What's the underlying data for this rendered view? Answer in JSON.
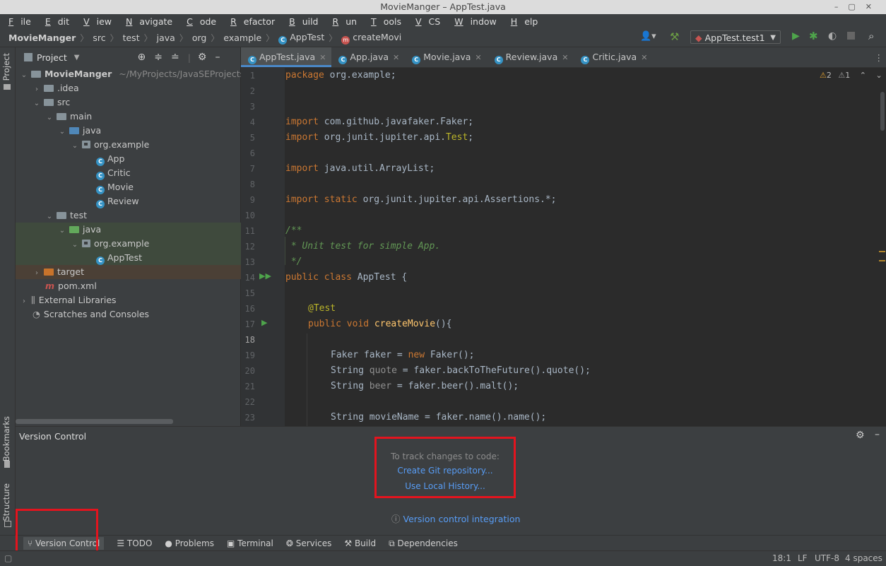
{
  "window": {
    "title": "MovieManger – AppTest.java"
  },
  "menu": {
    "items": [
      {
        "u": "F",
        "rest": "ile"
      },
      {
        "u": "E",
        "rest": "dit"
      },
      {
        "u": "V",
        "rest": "iew"
      },
      {
        "u": "N",
        "rest": "avigate"
      },
      {
        "u": "C",
        "rest": "ode"
      },
      {
        "u": "R",
        "rest": "efactor"
      },
      {
        "u": "B",
        "rest": "uild"
      },
      {
        "u": "R",
        "rest": "un"
      },
      {
        "u": "T",
        "rest": "ools"
      },
      {
        "u": "V",
        "rest": "CS"
      },
      {
        "u": "W",
        "rest": "indow"
      },
      {
        "u": "H",
        "rest": "elp"
      }
    ]
  },
  "breadcrumb": {
    "project": "MovieManger",
    "parts": [
      "src",
      "test",
      "java",
      "org",
      "example"
    ],
    "class": "AppTest",
    "method": "createMovi"
  },
  "run_config": {
    "label": "AppTest.test1"
  },
  "sidebar": {
    "project_tab": "Project",
    "bookmarks_tab": "Bookmarks",
    "structure_tab": "Structure"
  },
  "project_panel": {
    "title": "Project",
    "root_name": "MovieManger",
    "root_path": "~/MyProjects/JavaSEProjects/Cifo...",
    "nodes": {
      "idea": ".idea",
      "src": "src",
      "main": "main",
      "main_java": "java",
      "main_pkg": "org.example",
      "app": "App",
      "critic": "Critic",
      "movie": "Movie",
      "review": "Review",
      "test": "test",
      "test_java": "java",
      "test_pkg": "org.example",
      "apptest": "AppTest",
      "target": "target",
      "pom": "pom.xml",
      "ext_libs": "External Libraries",
      "scratches": "Scratches and Consoles"
    }
  },
  "editor": {
    "tabs": [
      "AppTest.java",
      "App.java",
      "Movie.java",
      "Review.java",
      "Critic.java"
    ],
    "active_tab": "AppTest.java",
    "warnings": "2",
    "weak_warnings": "1",
    "line_numbers": [
      "1",
      "2",
      "3",
      "4",
      "5",
      "6",
      "7",
      "8",
      "9",
      "10",
      "11",
      "12",
      "13",
      "14",
      "15",
      "16",
      "17",
      "18",
      "19",
      "20",
      "21",
      "22",
      "23"
    ],
    "code": {
      "l1_kw": "package",
      "l1_rest": " org.example;",
      "l4_kw": "import",
      "l4_rest": " com.github.javafaker.Faker;",
      "l5_kw": "import",
      "l5_rest_a": " org.junit.jupiter.api.",
      "l5_rest_b": "Test",
      "l5_rest_c": ";",
      "l7_kw": "import",
      "l7_rest": " java.util.ArrayList;",
      "l9_kw": "import static",
      "l9_rest": " org.junit.jupiter.api.Assertions.*;",
      "l11": "/**",
      "l12": " * Unit test for simple App.",
      "l13": " */",
      "l14_kw": "public class",
      "l14_rest": " AppTest {",
      "l16": "@Test",
      "l17_kw": "public void",
      "l17_fn": "createMovie",
      "l17_rest": "(){",
      "l19_a": "Faker faker = ",
      "l19_kw": "new",
      "l19_b": " Faker();",
      "l20_a": "String ",
      "l20_var": "quote",
      "l20_b": " = faker.backToTheFuture().quote();",
      "l21_a": "String ",
      "l21_var": "beer",
      "l21_b": " = faker.beer().malt();",
      "l23_a": "String movieName = faker.name().name();"
    }
  },
  "version_control": {
    "title": "Version Control",
    "hint": "To track changes to code:",
    "create_git": "Create Git repository...",
    "local_history": "Use Local History...",
    "integration": "Version control integration"
  },
  "bottom_tabs": [
    "Version Control",
    "TODO",
    "Problems",
    "Terminal",
    "Services",
    "Build",
    "Dependencies"
  ],
  "status": {
    "position": "18:1",
    "line_sep": "LF",
    "encoding": "UTF-8",
    "indent": "4 spaces"
  },
  "colors": {
    "highlight_box": "#e3141e",
    "link": "#589df6",
    "accent_tab": "#4a88c7"
  }
}
